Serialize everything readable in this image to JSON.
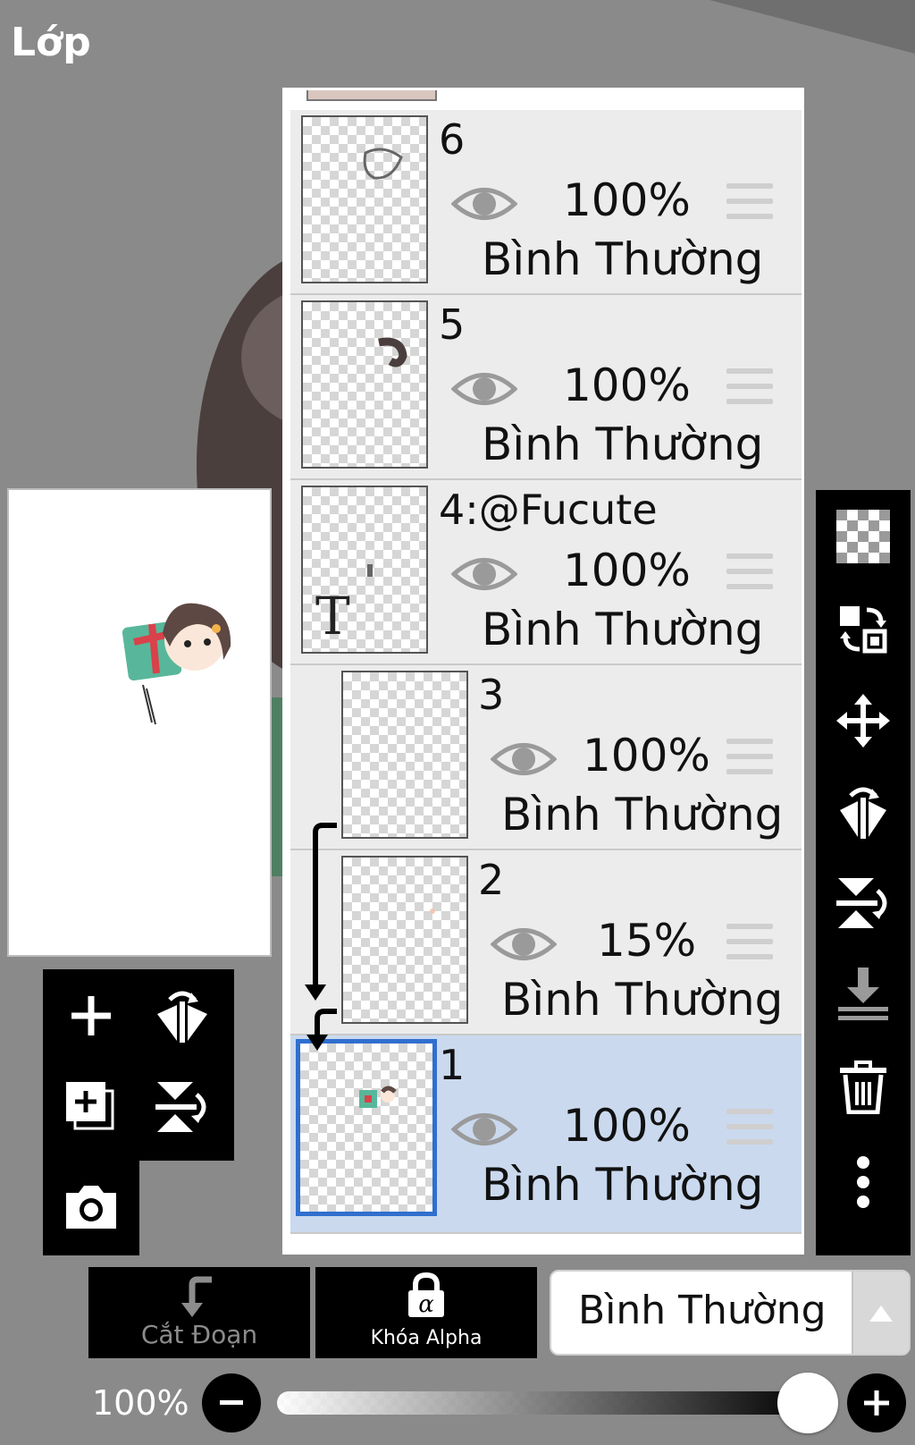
{
  "header": {
    "title": "Lớp"
  },
  "layers": [
    {
      "name": "6",
      "opacity": "100%",
      "blend": "Bình Thường",
      "visible": true,
      "selected": false,
      "clipped": false
    },
    {
      "name": "5",
      "opacity": "100%",
      "blend": "Bình Thường",
      "visible": true,
      "selected": false,
      "clipped": false
    },
    {
      "name": "4:@Fucute",
      "opacity": "100%",
      "blend": "Bình Thường",
      "visible": true,
      "selected": false,
      "clipped": false,
      "type": "text"
    },
    {
      "name": "3",
      "opacity": "100%",
      "blend": "Bình Thường",
      "visible": true,
      "selected": false,
      "clipped": true
    },
    {
      "name": "2",
      "opacity": "15%",
      "blend": "Bình Thường",
      "visible": true,
      "selected": false,
      "clipped": true
    },
    {
      "name": "1",
      "opacity": "100%",
      "blend": "Bình Thường",
      "visible": true,
      "selected": true,
      "clipped": false
    }
  ],
  "right_toolbar": [
    "transparency-icon",
    "swap-layers-icon",
    "move-icon",
    "flip-horizontal-icon",
    "flip-vertical-icon",
    "merge-down-icon",
    "trash-icon",
    "more-icon"
  ],
  "left_toolbar": [
    "add-layer-icon",
    "flip-horizontal-icon",
    "add-layer-copy-icon",
    "flip-vertical-icon",
    "camera-icon"
  ],
  "bottom": {
    "clip_label": "Cắt Đoạn",
    "alpha_lock_label": "Khóa Alpha",
    "blend_mode": "Bình Thường",
    "opacity_label": "100%",
    "opacity_value": 1.0
  },
  "colors": {
    "selected_row": "#cad9ee",
    "selection_border": "#2f6fcf",
    "toolbar": "#000000"
  }
}
